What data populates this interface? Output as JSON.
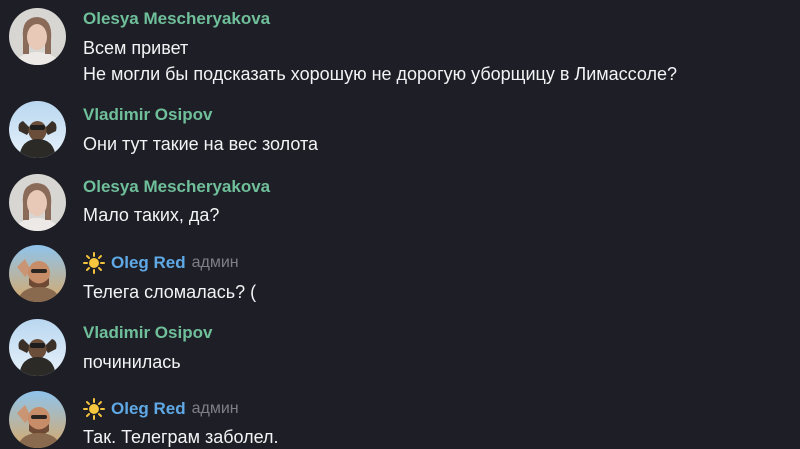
{
  "messages": [
    {
      "sender": "Olesya Mescheryakova",
      "lines": [
        "Всем привет",
        "Не могли бы подсказать хорошую не дорогую уборщицу в Лимассоле?"
      ]
    },
    {
      "sender": "Vladimir Osipov",
      "lines": [
        "Они тут такие на вес золота"
      ]
    },
    {
      "sender": "Olesya Mescheryakova",
      "lines": [
        "Мало таких, да?"
      ]
    },
    {
      "sender": "Oleg Red",
      "role": "админ",
      "lines": [
        "Телега сломалась? ("
      ]
    },
    {
      "sender": "Vladimir Osipov",
      "lines": [
        "починилась"
      ]
    },
    {
      "sender": "Oleg Red",
      "role": "админ",
      "lines": [
        "Так. Телеграм заболел."
      ]
    }
  ],
  "colors": {
    "background": "#1e1f26",
    "sender_green": "#6fbf9a",
    "sender_blue": "#5ea9e6",
    "role_gray": "#7d7f88",
    "text": "#f3f3f5"
  },
  "icons": {
    "sender_badge": "sun-icon",
    "avatar": "avatar-photo"
  }
}
